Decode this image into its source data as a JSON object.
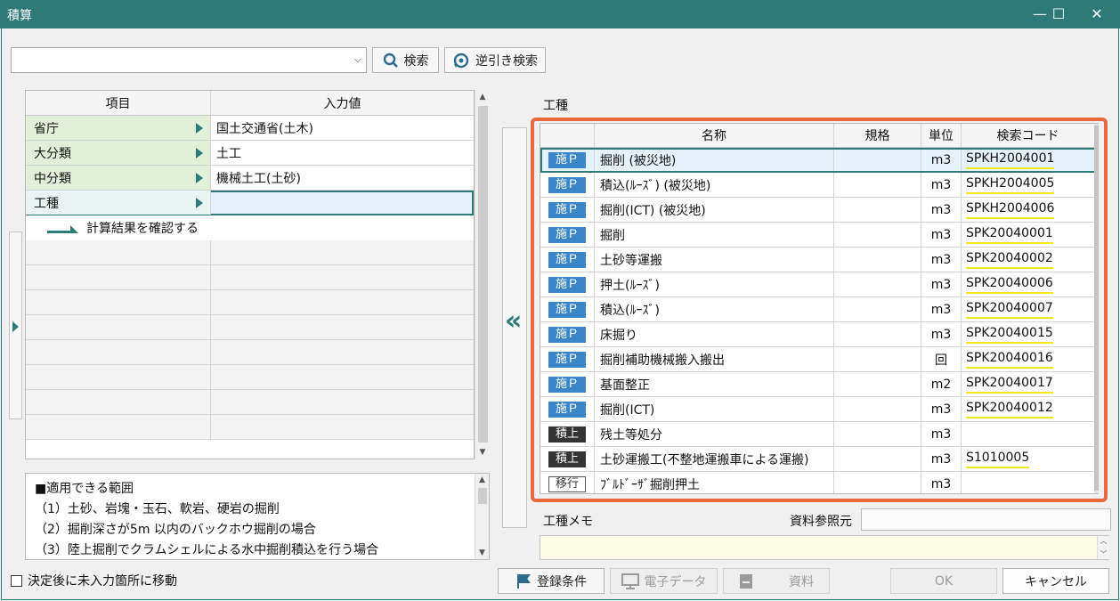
{
  "window": {
    "title": "積算",
    "minimize": "—",
    "maximize": "☐",
    "close": "✕"
  },
  "search": {
    "placeholder": "",
    "search_label": "検索",
    "reverse_label": "逆引き検索"
  },
  "left_table": {
    "headers": [
      "項目",
      "入力値"
    ],
    "rows": [
      {
        "label": "省庁",
        "value": "国土交通省(土木)"
      },
      {
        "label": "大分類",
        "value": "土工"
      },
      {
        "label": "中分類",
        "value": "機械土工(土砂)"
      },
      {
        "label": "工種",
        "value": ""
      }
    ],
    "calc_link": "計算結果を確認する"
  },
  "description": {
    "lines": [
      "■適用できる範囲",
      "（1）土砂、岩塊・玉石、軟岩、硬岩の掘削",
      "（2）掘削深さが5m 以内のバックホウ掘削の場合",
      "（3）陸上掘削でクラムシェルによる水中掘削積込を行う場合"
    ]
  },
  "checkbox": {
    "label": "決定後に未入力箇所に移動",
    "checked": false
  },
  "work_type": {
    "section_label": "工種",
    "headers": [
      "名称",
      "規格",
      "単位",
      "検索コード"
    ],
    "rows": [
      {
        "badge": "施Ｐ",
        "kind": "se",
        "name": "掘削 (被災地)",
        "spec": "",
        "unit": "m3",
        "code": "SPKH2004001"
      },
      {
        "badge": "施Ｐ",
        "kind": "se",
        "name": "積込(ﾙｰｽﾞ) (被災地)",
        "spec": "",
        "unit": "m3",
        "code": "SPKH2004005"
      },
      {
        "badge": "施Ｐ",
        "kind": "se",
        "name": "掘削(ICT) (被災地)",
        "spec": "",
        "unit": "m3",
        "code": "SPKH2004006"
      },
      {
        "badge": "施Ｐ",
        "kind": "se",
        "name": "掘削",
        "spec": "",
        "unit": "m3",
        "code": "SPK20040001"
      },
      {
        "badge": "施Ｐ",
        "kind": "se",
        "name": "土砂等運搬",
        "spec": "",
        "unit": "m3",
        "code": "SPK20040002"
      },
      {
        "badge": "施Ｐ",
        "kind": "se",
        "name": "押土(ﾙｰｽﾞ)",
        "spec": "",
        "unit": "m3",
        "code": "SPK20040006"
      },
      {
        "badge": "施Ｐ",
        "kind": "se",
        "name": "積込(ﾙｰｽﾞ)",
        "spec": "",
        "unit": "m3",
        "code": "SPK20040007"
      },
      {
        "badge": "施Ｐ",
        "kind": "se",
        "name": "床掘り",
        "spec": "",
        "unit": "m3",
        "code": "SPK20040015"
      },
      {
        "badge": "施Ｐ",
        "kind": "se",
        "name": "掘削補助機械搬入搬出",
        "spec": "",
        "unit": "回",
        "code": "SPK20040016"
      },
      {
        "badge": "施Ｐ",
        "kind": "se",
        "name": "基面整正",
        "spec": "",
        "unit": "m2",
        "code": "SPK20040017"
      },
      {
        "badge": "施Ｐ",
        "kind": "se",
        "name": "掘削(ICT)",
        "spec": "",
        "unit": "m3",
        "code": "SPK20040012"
      },
      {
        "badge": "積上",
        "kind": "seki",
        "name": "残土等処分",
        "spec": "",
        "unit": "m3",
        "code": ""
      },
      {
        "badge": "積上",
        "kind": "seki",
        "name": "土砂運搬工(不整地運搬車による運搬)",
        "spec": "",
        "unit": "m3",
        "code": "S1010005"
      },
      {
        "badge": "移行",
        "kind": "iko",
        "name": "ﾌﾞﾙﾄﾞｰｻﾞ掘削押土",
        "spec": "",
        "unit": "m3",
        "code": ""
      }
    ]
  },
  "memo": {
    "label": "工種メモ",
    "ref_label": "資料参照元",
    "value": ""
  },
  "footer": {
    "register": "登録条件",
    "edata": "電子データ",
    "material": "資料",
    "ok": "OK",
    "cancel": "キャンセル"
  },
  "collapse_glyph": "«",
  "colors": {
    "titlebar": "#2e7a78",
    "highlight": "#e8693b",
    "badge_se": "#3a86c8",
    "underline": "#f5e616"
  }
}
